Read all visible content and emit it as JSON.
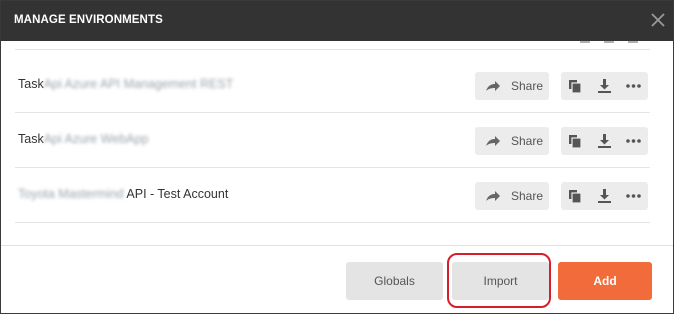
{
  "dialog": {
    "title": "MANAGE ENVIRONMENTS",
    "close_icon": "close-icon"
  },
  "environments": [
    {
      "name_prefix": "Task",
      "name_blurred": "Api Azure API Management REST",
      "name_suffix": "",
      "share_label": "Share"
    },
    {
      "name_prefix": "Task",
      "name_blurred": "Api Azure WebApp",
      "name_suffix": "",
      "share_label": "Share"
    },
    {
      "name_prefix": "",
      "name_blurred": "Toyota Mastermind",
      "name_suffix": " API - Test Account",
      "share_label": "Share"
    }
  ],
  "row_icons": [
    "share-arrow-icon",
    "duplicate-icon",
    "download-icon",
    "more-icon"
  ],
  "footer": {
    "globals_label": "Globals",
    "import_label": "Import",
    "add_label": "Add"
  },
  "colors": {
    "header_bg": "#333333",
    "accent": "#f26b3a",
    "highlight": "#d81e2a",
    "button_bg": "#e4e4e4"
  }
}
